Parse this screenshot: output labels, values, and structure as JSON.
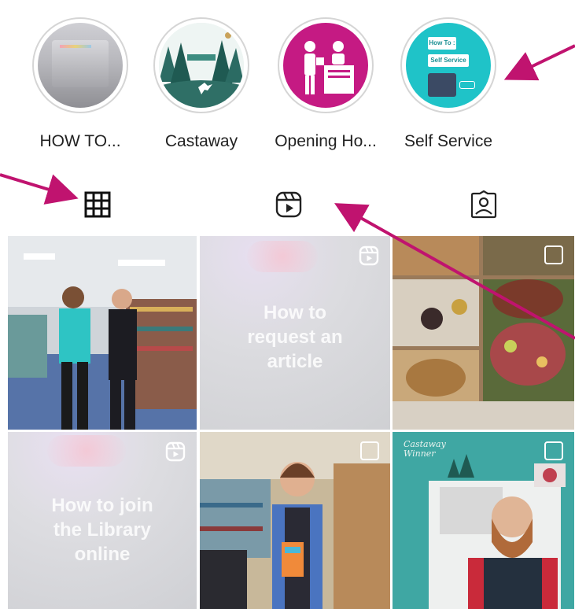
{
  "highlights": [
    {
      "label": "HOW TO...",
      "icon": "how-to-highlight"
    },
    {
      "label": "Castaway",
      "icon": "winter-forest-highlight"
    },
    {
      "label": "Opening Ho...",
      "icon": "library-desk-highlight"
    },
    {
      "label": "Self Service",
      "icon": "self-service-highlight",
      "card_line1": "How To :",
      "card_line2": "Self Service"
    }
  ],
  "tabs": [
    {
      "name": "grid",
      "icon": "grid-icon",
      "active": true
    },
    {
      "name": "reels",
      "icon": "reels-icon",
      "active": false
    },
    {
      "name": "tagged",
      "icon": "tagged-icon",
      "active": false
    }
  ],
  "posts": [
    {
      "type": "photo",
      "caption": ""
    },
    {
      "type": "reel",
      "caption": "How to request an article"
    },
    {
      "type": "carousel",
      "caption": ""
    },
    {
      "type": "reel",
      "caption": "How to join the Library online"
    },
    {
      "type": "carousel",
      "caption": ""
    },
    {
      "type": "carousel",
      "caption": "",
      "overlay_text": "Castaway Winner"
    }
  ],
  "colors": {
    "accent": "#c0136f",
    "teal": "#1fc3c8",
    "magenta": "#c51a83"
  }
}
